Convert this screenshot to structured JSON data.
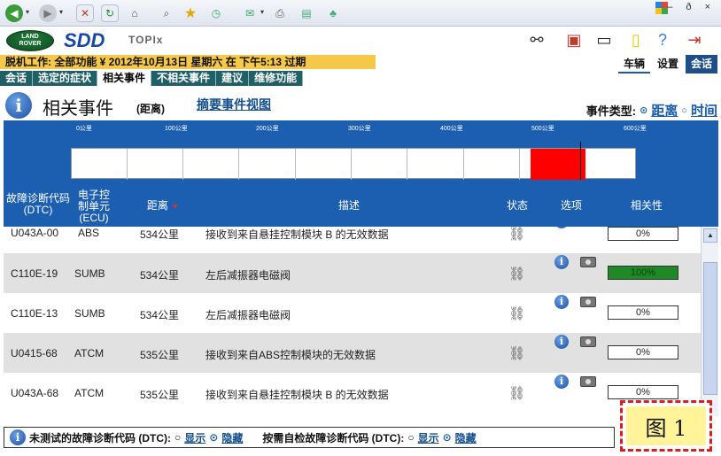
{
  "browser": {
    "controls": "– ð ×"
  },
  "header": {
    "brand": "LAND ROVER",
    "brand_line1": "LAND",
    "brand_line2": "ROVER",
    "app": "SDD",
    "product": "TOPIx"
  },
  "session": {
    "text": "脱机工作: 全部功能  ¥  2012年10月13日  星期六  在  下午5:13 过期"
  },
  "right_nav": [
    "车辆",
    "设置",
    "会话"
  ],
  "tabs": [
    "会话",
    "选定的症状",
    "相关事件",
    "不相关事件",
    "建议",
    "维修功能"
  ],
  "title": {
    "text": "相关事件",
    "mode": "(距离)",
    "summary_link": "摘要事件视图"
  },
  "event_type": {
    "label": "事件类型:",
    "opt1": "距离",
    "opt2": "时间"
  },
  "timeline": {
    "labels": [
      "0公里",
      "100公里",
      "200公里",
      "300公里",
      "400公里",
      "500公里",
      "600公里"
    ],
    "hit_start_km": 534,
    "hit_end_km": 535
  },
  "table": {
    "headers": {
      "dtc": "故障诊断代码\n(DTC)",
      "ecu": "电子控\n制单元\n(ECU)",
      "distance": "距离",
      "desc": "描述",
      "status": "状态",
      "options": "选项",
      "relevance": "相关性"
    },
    "rows": [
      {
        "dtc": "U043A-00",
        "ecu": "ABS",
        "dist": "534公里",
        "desc": "接收到来自悬挂控制模块 B 的无效数据",
        "rel": "0%"
      },
      {
        "dtc": "C110E-19",
        "ecu": "SUMB",
        "dist": "534公里",
        "desc": "左后减振器电磁阀",
        "rel": "100%"
      },
      {
        "dtc": "C110E-13",
        "ecu": "SUMB",
        "dist": "534公里",
        "desc": "左后减振器电磁阀",
        "rel": "0%"
      },
      {
        "dtc": "U0415-68",
        "ecu": "ATCM",
        "dist": "535公里",
        "desc": "接收到来自ABS控制模块的无效数据",
        "rel": "0%"
      },
      {
        "dtc": "U043A-68",
        "ecu": "ATCM",
        "dist": "535公里",
        "desc": "接收到来自悬挂控制模块 B 的无效数据",
        "rel": "0%"
      }
    ]
  },
  "footer": {
    "untested_label": "未测试的故障诊断代码 (DTC):",
    "show": "显示",
    "hide": "隐藏",
    "ondemand_label": "按需自检故障诊断代码 (DTC):"
  },
  "figure_label": "图 1",
  "colors": {
    "accent_blue": "#1c5fb0",
    "tab_teal": "#1f5f66",
    "session_yellow": "#f6c84a",
    "hit_red": "#ff0000",
    "relevance_green": "#1f8a25"
  }
}
